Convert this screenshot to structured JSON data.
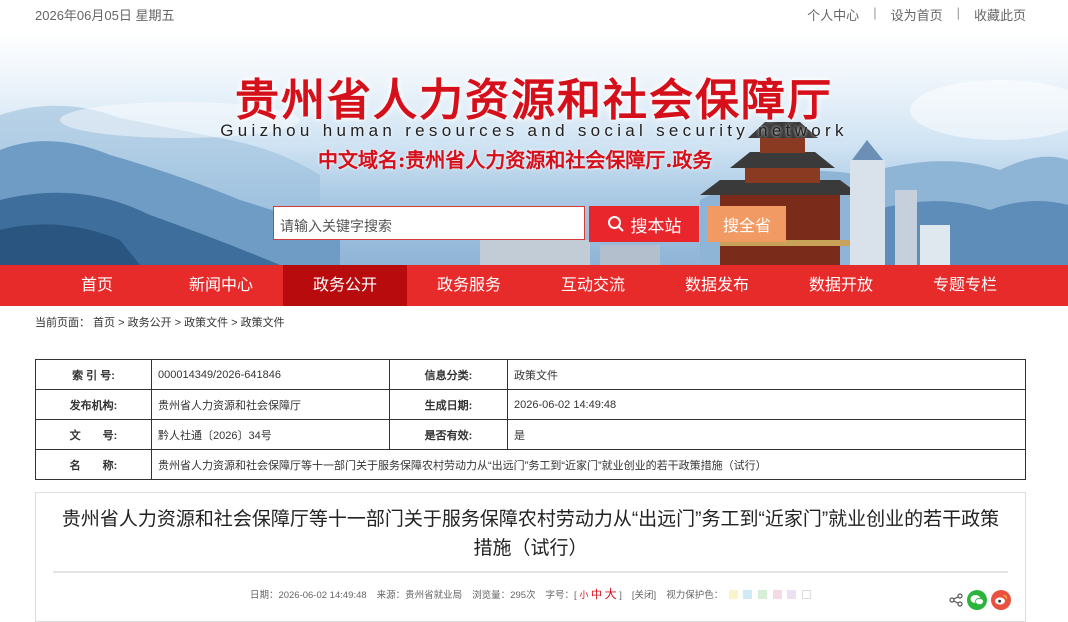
{
  "topbar": {
    "date": "2026年06月05日 星期五",
    "links": [
      "个人中心",
      "设为首页",
      "收藏此页"
    ],
    "separator": "|"
  },
  "header": {
    "title": "贵州省人力资源和社会保障厅",
    "subtitle_en": "Guizhou human resources and social security network",
    "domain": "中文域名:贵州省人力资源和社会保障厅.政务"
  },
  "search": {
    "placeholder": "请输入关键字搜索",
    "site_button": "搜本站",
    "province_button": "搜全省"
  },
  "nav": {
    "items": [
      "首页",
      "新闻中心",
      "政务公开",
      "政务服务",
      "互动交流",
      "数据发布",
      "数据开放",
      "专题专栏"
    ],
    "active_index": 2
  },
  "breadcrumb": "当前页面： 首页 > 政务公开 > 政策文件 > 政策文件",
  "info": {
    "index_label": "索 引 号:",
    "index_value": "000014349/2026-641846",
    "category_label": "信息分类:",
    "category_value": "政策文件",
    "publisher_label": "发布机构:",
    "publisher_value": "贵州省人力资源和社会保障厅",
    "created_label": "生成日期:",
    "created_value": "2026-06-02 14:49:48",
    "docno_label": "文　　号:",
    "docno_value": "黔人社通〔2026〕34号",
    "valid_label": "是否有效:",
    "valid_value": "是",
    "name_label": "名　　称:",
    "name_value": "贵州省人力资源和社会保障厅等十一部门关于服务保障农村劳动力从“出远门”务工到“近家门”就业创业的若干政策措施（试行）"
  },
  "article": {
    "title": "贵州省人力资源和社会保障厅等十一部门关于服务保障农村劳动力从“出远门”务工到“近家门”就业创业的若干政策措施（试行）",
    "meta_date": "日期：2026-06-02 14:49:48",
    "meta_source": "来源：贵州省就业局",
    "meta_views": "浏览量：295次",
    "font_label": "字号：[",
    "font_small": "小",
    "font_mid": "中",
    "font_big": "大",
    "font_end": "]",
    "close_label": "[关闭]",
    "eye_label": "视力保护色：",
    "eye_colors": [
      "#faf5c8",
      "#cfe9f7",
      "#d6efd6",
      "#f5d9e6",
      "#ece0f2",
      "#ffffff"
    ]
  },
  "colors": {
    "nav_bg": "#e72a2a",
    "nav_active": "#b80b0d",
    "title_red": "#d6101a",
    "search_orange": "#f29a63"
  }
}
